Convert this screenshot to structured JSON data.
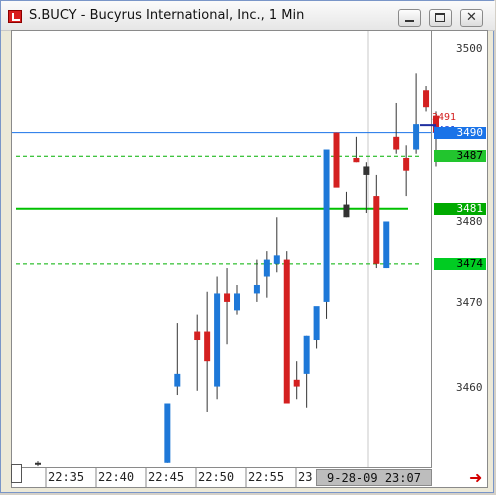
{
  "window": {
    "title": "S.BUCY - Bucyrus International, Inc., 1 Min",
    "minimize_label": "minimize",
    "maximize_label": "maximize",
    "close_label": "✕"
  },
  "price_axis": {
    "ticks": [
      {
        "label": "3500",
        "value": 3500
      },
      {
        "label": "3470",
        "value": 3470
      },
      {
        "label": "3460",
        "value": 3460
      }
    ],
    "highlighted_labels": [
      {
        "label": "3490",
        "value": 3490,
        "bg": "#1a73e8",
        "fg": "#ffffff"
      },
      {
        "label": "3487",
        "value": 3487.2,
        "bg": "#22c52e",
        "fg": "#000000"
      },
      {
        "label": "3481",
        "value": 3481,
        "bg": "#00aa00",
        "fg": "#ffffff"
      },
      {
        "label": "3474",
        "value": 3474.5,
        "bg": "#00cc22",
        "fg": "#000000"
      }
    ],
    "partial_tick": "3480"
  },
  "time_axis": {
    "ticks": [
      "22:35",
      "22:40",
      "22:45",
      "22:50",
      "22:55",
      "23"
    ],
    "cursor_label": "9-28-09  23:07"
  },
  "annotations": {
    "bid_label": "3491",
    "ask_label": "3481"
  },
  "colors": {
    "up": "#1e78d8",
    "down": "#d42020",
    "blue_line": "#1a73e8",
    "green_solid": "#00c000",
    "green_dashed": "#00b000"
  },
  "chart_data": {
    "type": "candlestick",
    "title": "S.BUCY - Bucyrus International, Inc., 1 Min",
    "x_ticks": [
      "22:35",
      "22:40",
      "22:45",
      "22:50",
      "22:55",
      "23"
    ],
    "ylim": [
      3450.5,
      3502
    ],
    "hlines": [
      {
        "value": 3490,
        "style": "solid",
        "color": "blue"
      },
      {
        "value": 3487.2,
        "style": "dashed",
        "color": "green"
      },
      {
        "value": 3481,
        "style": "solid",
        "color": "green"
      },
      {
        "value": 3474.5,
        "style": "dashed",
        "color": "green"
      }
    ],
    "candles": [
      {
        "i": 0,
        "open": 3451,
        "high": 3451.2,
        "low": 3450.6,
        "close": 3451,
        "dir": "flat"
      },
      {
        "i": 13,
        "open": 3451,
        "high": 3458,
        "low": 3451,
        "close": 3458,
        "dir": "up"
      },
      {
        "i": 14,
        "open": 3460,
        "high": 3467.5,
        "low": 3459,
        "close": 3461.5,
        "dir": "up"
      },
      {
        "i": 16,
        "open": 3466.5,
        "high": 3468.5,
        "low": 3459.5,
        "close": 3465.5,
        "dir": "down"
      },
      {
        "i": 17,
        "open": 3466.5,
        "high": 3471.2,
        "low": 3457,
        "close": 3463,
        "dir": "down"
      },
      {
        "i": 18,
        "open": 3460,
        "high": 3473,
        "low": 3458.5,
        "close": 3471,
        "dir": "up"
      },
      {
        "i": 19,
        "open": 3471,
        "high": 3474,
        "low": 3465,
        "close": 3470,
        "dir": "down"
      },
      {
        "i": 20,
        "open": 3469,
        "high": 3472,
        "low": 3468.5,
        "close": 3471,
        "dir": "up"
      },
      {
        "i": 22,
        "open": 3471,
        "high": 3475,
        "low": 3470,
        "close": 3472,
        "dir": "up"
      },
      {
        "i": 23,
        "open": 3473,
        "high": 3476,
        "low": 3470.5,
        "close": 3475,
        "dir": "up"
      },
      {
        "i": 24,
        "open": 3474.5,
        "high": 3480,
        "low": 3473.5,
        "close": 3475.5,
        "dir": "up"
      },
      {
        "i": 25,
        "open": 3475,
        "high": 3476,
        "low": 3458,
        "close": 3458,
        "dir": "down"
      },
      {
        "i": 26,
        "open": 3460,
        "high": 3463,
        "low": 3458.5,
        "close": 3460.8,
        "dir": "down"
      },
      {
        "i": 27,
        "open": 3461.5,
        "high": 3466,
        "low": 3457.5,
        "close": 3466,
        "dir": "up"
      },
      {
        "i": 28,
        "open": 3465.5,
        "high": 3467,
        "low": 3464.5,
        "close": 3469.5,
        "dir": "up"
      },
      {
        "i": 29,
        "open": 3470,
        "high": 3485,
        "low": 3468,
        "close": 3488,
        "dir": "up"
      },
      {
        "i": 30,
        "open": 3490,
        "high": 3490,
        "low": 3484.8,
        "close": 3483.5,
        "dir": "down"
      },
      {
        "i": 31,
        "open": 3480,
        "high": 3483,
        "low": 3480,
        "close": 3481.5,
        "dir": "flat"
      },
      {
        "i": 32,
        "open": 3487,
        "high": 3489.5,
        "low": 3486.5,
        "close": 3486.5,
        "dir": "down"
      },
      {
        "i": 33,
        "open": 3485,
        "high": 3486.5,
        "low": 3480.5,
        "close": 3486,
        "dir": "flat"
      },
      {
        "i": 34,
        "open": 3482.5,
        "high": 3485,
        "low": 3474,
        "close": 3474.5,
        "dir": "down"
      },
      {
        "i": 35,
        "open": 3474,
        "high": 3479,
        "low": 3474,
        "close": 3479.5,
        "dir": "up"
      },
      {
        "i": 36,
        "open": 3489.5,
        "high": 3493.5,
        "low": 3487.5,
        "close": 3488,
        "dir": "down"
      },
      {
        "i": 37,
        "open": 3487,
        "high": 3488.5,
        "low": 3482.5,
        "close": 3485.5,
        "dir": "down"
      },
      {
        "i": 38,
        "open": 3488,
        "high": 3497,
        "low": 3487.5,
        "close": 3491,
        "dir": "up"
      },
      {
        "i": 39,
        "open": 3495,
        "high": 3495.5,
        "low": 3492.5,
        "close": 3493,
        "dir": "down"
      },
      {
        "i": 40,
        "open": 3492,
        "high": 3492.5,
        "low": 3486,
        "close": 3490,
        "dir": "down"
      }
    ]
  }
}
